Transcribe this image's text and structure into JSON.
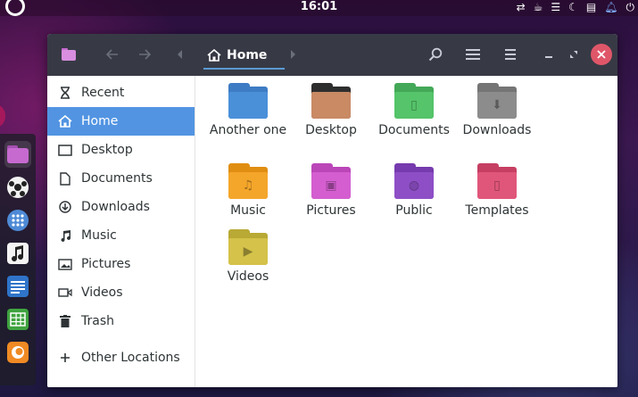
{
  "topbar": {
    "clock": "16:01",
    "icons": [
      "activities-icon",
      "network-icon",
      "coffee-icon",
      "menu-icon",
      "night-icon",
      "clipboard-icon",
      "notification-bell-icon",
      "power-icon"
    ]
  },
  "dock": {
    "items": [
      {
        "name": "files-app",
        "color": "#c66ad0"
      },
      {
        "name": "soccer-app",
        "color": "#333333"
      },
      {
        "name": "app-grid",
        "color": "#4e8ad6"
      },
      {
        "name": "music-app",
        "color": "#eeeeee"
      },
      {
        "name": "text-editor-app",
        "color": "#2f74c9"
      },
      {
        "name": "spreadsheet-app",
        "color": "#3fa33f"
      },
      {
        "name": "firefox-app",
        "color": "#f08a24"
      }
    ]
  },
  "window": {
    "title_icon": "folder-icon",
    "path": {
      "current": "Home"
    },
    "close_color": "#e05669",
    "accent": "#5294e2"
  },
  "sidebar": {
    "items": [
      {
        "label": "Recent",
        "icon": "hourglass-icon",
        "active": false
      },
      {
        "label": "Home",
        "icon": "home-icon",
        "active": true
      },
      {
        "label": "Desktop",
        "icon": "desktop-icon",
        "active": false
      },
      {
        "label": "Documents",
        "icon": "document-icon",
        "active": false
      },
      {
        "label": "Downloads",
        "icon": "download-icon",
        "active": false
      },
      {
        "label": "Music",
        "icon": "music-icon",
        "active": false
      },
      {
        "label": "Pictures",
        "icon": "picture-icon",
        "active": false
      },
      {
        "label": "Videos",
        "icon": "video-icon",
        "active": false
      },
      {
        "label": "Trash",
        "icon": "trash-icon",
        "active": false
      }
    ],
    "other_locations": {
      "label": "Other Locations",
      "icon": "plus-icon"
    }
  },
  "folders": [
    {
      "label": "Another one",
      "color": "#4a90d9",
      "tab": "#3d7cc4",
      "glyph": "",
      "row": 0,
      "col": 0
    },
    {
      "label": "Desktop",
      "color": "#c98a64",
      "tab": "#2e2e2e",
      "glyph": "",
      "row": 0,
      "col": 1
    },
    {
      "label": "Documents",
      "color": "#55c46a",
      "tab": "#43a857",
      "glyph": "▯",
      "row": 0,
      "col": 2
    },
    {
      "label": "Downloads",
      "color": "#8c8c8c",
      "tab": "#757575",
      "glyph": "⬇",
      "row": 0,
      "col": 3
    },
    {
      "label": "Music",
      "color": "#f4a62a",
      "tab": "#e08e12",
      "glyph": "♫",
      "row": 1,
      "col": 0
    },
    {
      "label": "Pictures",
      "color": "#d45ed0",
      "tab": "#bb46b8",
      "glyph": "▣",
      "row": 1,
      "col": 1
    },
    {
      "label": "Public",
      "color": "#8e4fc6",
      "tab": "#763bae",
      "glyph": "◍",
      "row": 1,
      "col": 2
    },
    {
      "label": "Templates",
      "color": "#e0567a",
      "tab": "#c63f63",
      "glyph": "▯",
      "row": 1,
      "col": 3
    },
    {
      "label": "Videos",
      "color": "#d4c24a",
      "tab": "#b9a935",
      "glyph": "▶",
      "row": 2,
      "col": 0
    }
  ]
}
